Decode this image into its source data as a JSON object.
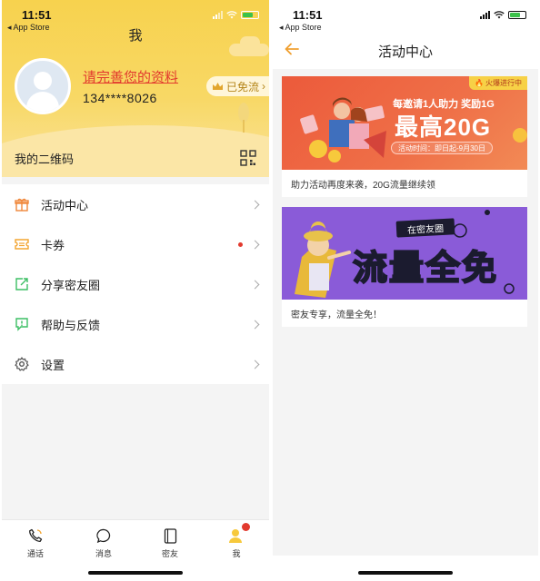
{
  "left": {
    "status": {
      "time": "11:51",
      "back_app": "◂ App Store"
    },
    "title": "我",
    "profile": {
      "prompt": "请完善您的资料",
      "phone": "134****8026",
      "free_badge": "已免流"
    },
    "qr": {
      "label": "我的二维码"
    },
    "menu": [
      {
        "label": "活动中心",
        "icon": "gift-icon",
        "icon_color": "#f0873a"
      },
      {
        "label": "卡券",
        "icon": "ticket-icon",
        "icon_color": "#f3a531"
      },
      {
        "label": "分享密友圈",
        "icon": "share-icon",
        "icon_color": "#3cbf64"
      },
      {
        "label": "帮助与反馈",
        "icon": "feedback-icon",
        "icon_color": "#3cbf64"
      },
      {
        "label": "设置",
        "icon": "gear-icon",
        "icon_color": "#555555"
      }
    ],
    "tabs": [
      {
        "label": "通话",
        "icon": "phone-icon"
      },
      {
        "label": "消息",
        "icon": "message-icon"
      },
      {
        "label": "密友",
        "icon": "friends-icon"
      },
      {
        "label": "我",
        "icon": "me-icon"
      }
    ]
  },
  "right": {
    "status": {
      "time": "11:51",
      "back_app": "◂ App Store"
    },
    "title": "活动中心",
    "cards": [
      {
        "hot_tag": "火爆进行中",
        "headline": "每邀请1人助力 奖励1G",
        "big_text": "最高20G",
        "period": "活动时间：即日起-9月30日",
        "caption": "助力活动再度来袭，20G流量继续领"
      },
      {
        "tag": "在密友圈",
        "big_text_part1": "流量",
        "big_text_highlight": "全",
        "big_text_part2": "免",
        "caption": "密友专享，流量全免！"
      }
    ]
  },
  "colors": {
    "accent_yellow": "#f7d24e",
    "accent_orange": "#f0a030",
    "alert_red": "#e23a2e"
  }
}
